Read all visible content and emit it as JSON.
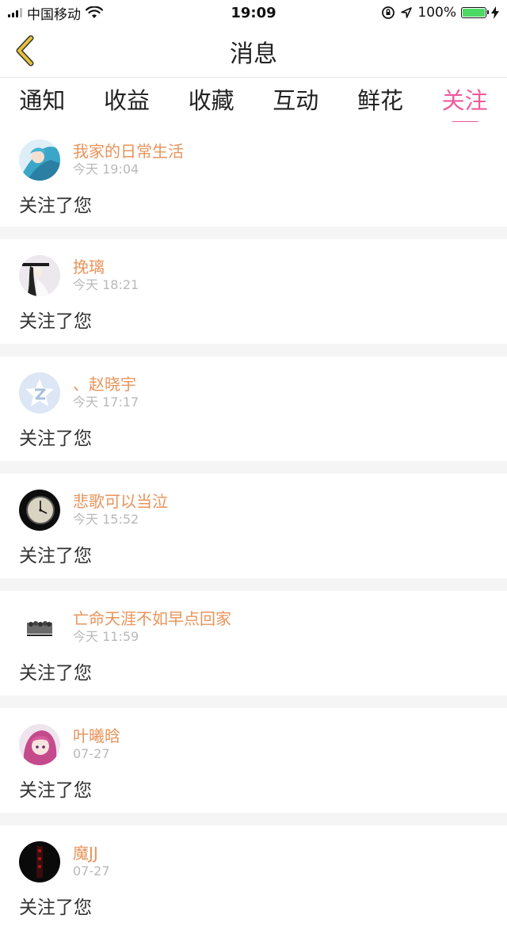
{
  "status_bar": {
    "carrier": "中国移动",
    "time": "19:09",
    "battery_pct": "100%",
    "battery_level": 1.0,
    "battery_color": "#4cd964"
  },
  "nav": {
    "title": "消息",
    "back_icon": "chevron-left-icon",
    "back_color": "#e6c13a"
  },
  "tabs": [
    {
      "label": "通知",
      "active": false
    },
    {
      "label": "收益",
      "active": false
    },
    {
      "label": "收藏",
      "active": false
    },
    {
      "label": "互动",
      "active": false
    },
    {
      "label": "鲜花",
      "active": false
    },
    {
      "label": "关注",
      "active": true
    }
  ],
  "accent_color": "#ee5b9d",
  "username_color": "#e8945b",
  "notifications": [
    {
      "username": "我家的日常生活",
      "time": "今天 19:04",
      "message": "关注了您",
      "avatar": "anime-blue-hair-avatar"
    },
    {
      "username": "挽璃",
      "time": "今天 18:21",
      "message": "关注了您",
      "avatar": "ink-painting-avatar"
    },
    {
      "username": "、赵晓宇",
      "time": "今天 17:17",
      "message": "关注了您",
      "avatar": "default-qq-avatar"
    },
    {
      "username": "悲歌可以当泣",
      "time": "今天 15:52",
      "message": "关注了您",
      "avatar": "clock-photo-avatar"
    },
    {
      "username": "亡命天涯不如早点回家",
      "time": "今天 11:59",
      "message": "关注了您",
      "avatar": "group-photo-avatar"
    },
    {
      "username": "叶曦晗",
      "time": "07-27",
      "message": "关注了您",
      "avatar": "anime-pink-hair-avatar"
    },
    {
      "username": "魔JJ",
      "time": "07-27",
      "message": "关注了您",
      "avatar": "dark-photo-avatar"
    }
  ]
}
